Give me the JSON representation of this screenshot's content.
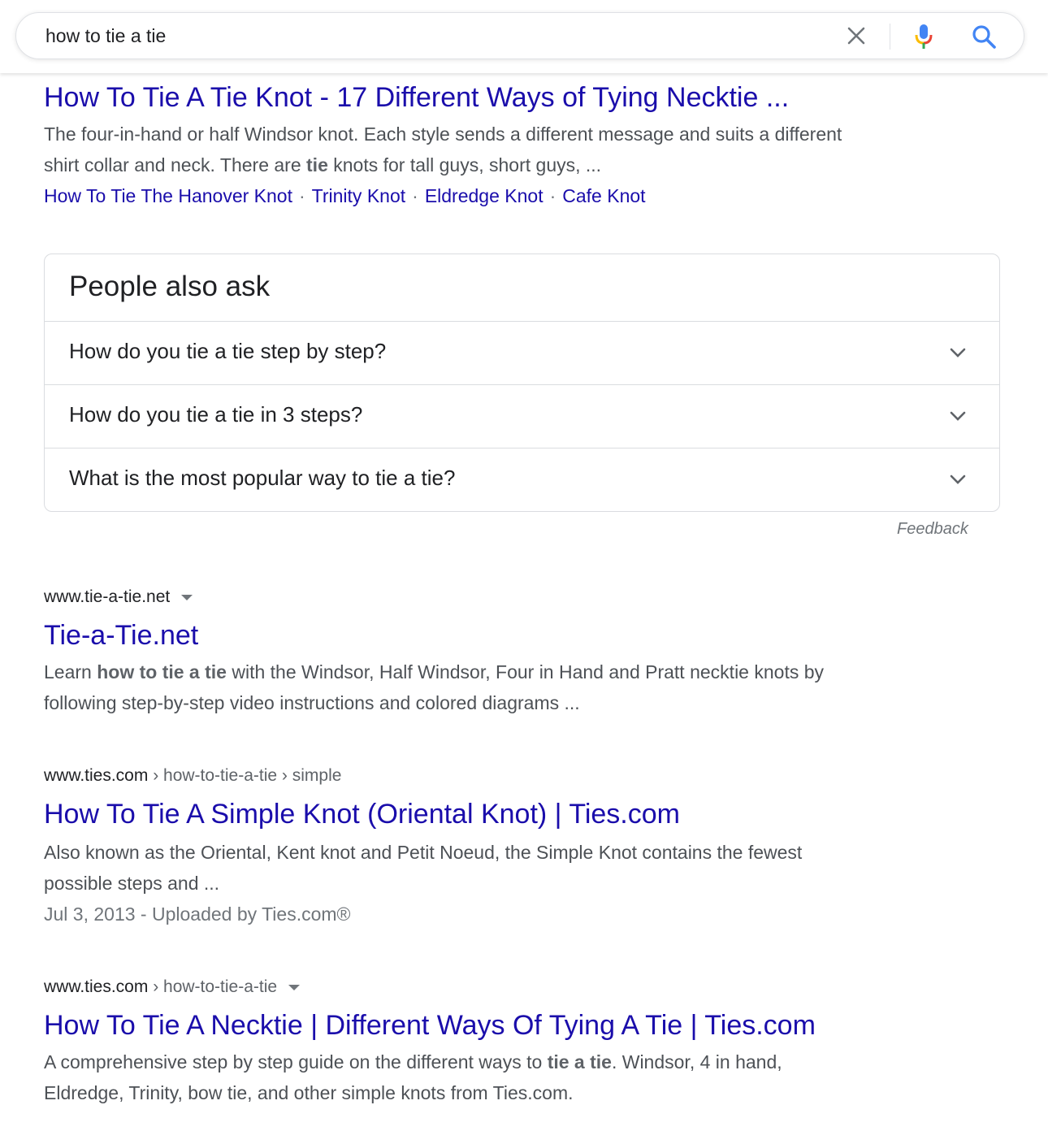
{
  "search": {
    "query": "how to tie a tie"
  },
  "result1": {
    "title": "How To Tie A Tie Knot - 17 Different Ways of Tying Necktie ...",
    "snippet_line1": "The four-in-hand or half Windsor knot. Each style sends a different message and suits a different",
    "snippet_line2_pre": "shirt collar and neck. There are ",
    "snippet_line2_bold": "tie",
    "snippet_line2_post": " knots for tall guys, short guys, ...",
    "sitelinks": [
      "How To Tie The Hanover Knot",
      "Trinity Knot",
      "Eldredge Knot",
      "Cafe Knot"
    ],
    "separator": "·"
  },
  "paa": {
    "heading": "People also ask",
    "questions": [
      "How do you tie a tie step by step?",
      "How do you tie a tie in 3 steps?",
      "What is the most popular way to tie a tie?"
    ],
    "feedback": "Feedback"
  },
  "result2": {
    "cite": "www.tie-a-tie.net",
    "title": "Tie-a-Tie.net",
    "snippet_line1_pre": "Learn ",
    "snippet_line1_bold": "how to tie a tie",
    "snippet_line1_post": " with the Windsor, Half Windsor, Four in Hand and Pratt necktie knots by",
    "snippet_line2": "following step-by-step video instructions and colored diagrams ..."
  },
  "result3": {
    "cite_domain": "www.ties.com",
    "cite_path": " › how-to-tie-a-tie › simple",
    "title": "How To Tie A Simple Knot (Oriental Knot) | Ties.com",
    "snippet_line1": "Also known as the Oriental, Kent knot and Petit Noeud, the Simple Knot contains the fewest",
    "snippet_line2": "possible steps and ...",
    "date_line": "Jul 3, 2013 - Uploaded by Ties.com®"
  },
  "result4": {
    "cite_domain": "www.ties.com",
    "cite_path": " › how-to-tie-a-tie",
    "title": "How To Tie A Necktie | Different Ways Of Tying A Tie | Ties.com",
    "snippet_line1_pre": "A comprehensive step by step guide on the different ways to ",
    "snippet_line1_bold": "tie a tie",
    "snippet_line1_post": ". Windsor, 4 in hand,",
    "snippet_line2": "Eldredge, Trinity, bow tie, and other simple knots from Ties.com."
  },
  "icons": {
    "clear": "close-icon",
    "mic": "microphone-icon",
    "search": "search-icon",
    "expand": "chevron-down-icon",
    "menu": "caret-down-icon"
  },
  "colors": {
    "link": "#1a0dab",
    "snippet": "#4d5156",
    "search_blue": "#4285f4",
    "mic_red": "#ea4335",
    "mic_yellow": "#fbbc05",
    "mic_green": "#34a853"
  }
}
